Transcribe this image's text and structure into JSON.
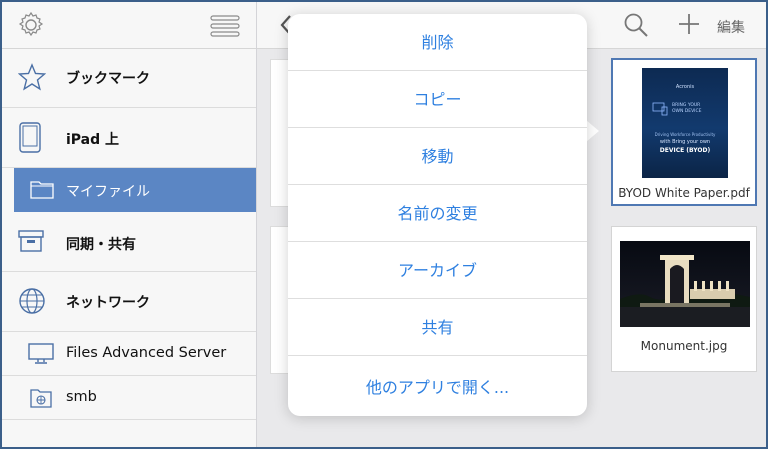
{
  "sidebar": {
    "items": [
      {
        "label": "ブックマーク"
      },
      {
        "label": "iPad 上"
      },
      {
        "label": "マイファイル"
      },
      {
        "label": "同期・共有"
      },
      {
        "label": "ネットワーク"
      },
      {
        "label": "Files Advanced Server"
      },
      {
        "label": "smb"
      }
    ]
  },
  "toolbar": {
    "edit_label": "編集"
  },
  "files": [
    {
      "name": "BYOD White Paper.pdf",
      "cover": {
        "brand": "Acronis",
        "line1": "BRING YOUR",
        "line2": "OWN DEVICE",
        "line3": "Driving Workforce Productivity",
        "line4": "with Bring your own",
        "line5": "DEVICE (BYOD)"
      }
    },
    {
      "name": "Monument.jpg"
    }
  ],
  "popover": {
    "items": [
      {
        "label": "削除"
      },
      {
        "label": "コピー"
      },
      {
        "label": "移動"
      },
      {
        "label": "名前の変更"
      },
      {
        "label": "アーカイブ"
      },
      {
        "label": "共有"
      },
      {
        "label": "他のアプリで開く..."
      }
    ]
  },
  "colors": {
    "accent": "#2f80e0",
    "selection": "#5b86c4",
    "frame": "#3b5f8a"
  }
}
